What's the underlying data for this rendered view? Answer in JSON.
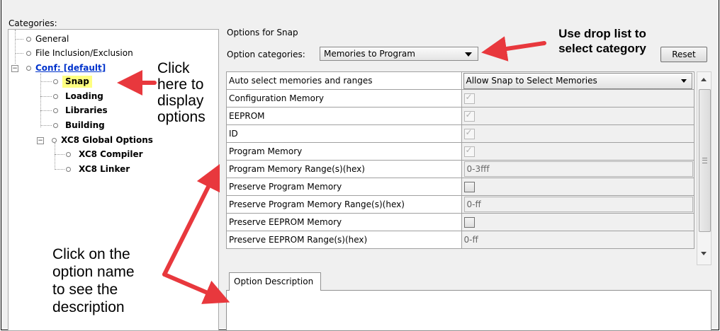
{
  "categories_label": "Categories:",
  "tree": {
    "general": "General",
    "file_inclusion": "File Inclusion/Exclusion",
    "conf": "Conf: [default]",
    "snap": "Snap",
    "loading": "Loading",
    "libraries": "Libraries",
    "building": "Building",
    "xc8_global": "XC8 Global Options",
    "xc8_compiler": "XC8 Compiler",
    "xc8_linker": "XC8 Linker",
    "expand_symbol": "−"
  },
  "options_for": "Options for Snap",
  "option_categories_label": "Option categories:",
  "option_categories_value": "Memories to Program",
  "reset_label": "Reset",
  "options": [
    {
      "name": "Auto select memories and ranges",
      "type": "select",
      "value": "Allow Snap to Select Memories"
    },
    {
      "name": "Configuration Memory",
      "type": "checkbox",
      "checked": true
    },
    {
      "name": "EEPROM",
      "type": "checkbox",
      "checked": true
    },
    {
      "name": "ID",
      "type": "checkbox",
      "checked": true
    },
    {
      "name": "Program Memory",
      "type": "checkbox",
      "checked": true
    },
    {
      "name": "Program Memory Range(s)(hex)",
      "type": "text",
      "value": "0-3fff"
    },
    {
      "name": "Preserve Program Memory",
      "type": "checkbox",
      "checked": false
    },
    {
      "name": "Preserve Program Memory Range(s)(hex)",
      "type": "text",
      "value": "0-ff"
    },
    {
      "name": "Preserve EEPROM Memory",
      "type": "checkbox",
      "checked": false
    },
    {
      "name": "Preserve EEPROM Range(s)(hex)",
      "type": "text",
      "value": "0-ff"
    }
  ],
  "option_description_tab": "Option Description",
  "annotations": {
    "drop_list_1": "Use drop list to",
    "drop_list_2": "select category",
    "click_1": "Click",
    "click_2": "here to",
    "click_3": "display",
    "click_4": "options",
    "desc_1": "Click on the",
    "desc_2": "option name",
    "desc_3": "to see the",
    "desc_4": "description"
  },
  "colors": {
    "arrow": "#e8383d",
    "link": "#0033cc",
    "highlight": "#ffff80"
  }
}
